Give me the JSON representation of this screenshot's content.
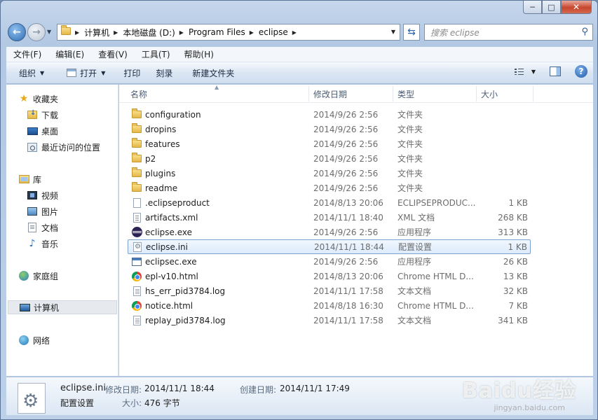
{
  "window": {
    "minimize_label": "─",
    "maximize_label": "□",
    "close_label": "✕"
  },
  "address": {
    "crumbs": [
      "计算机",
      "本地磁盘 (D:)",
      "Program Files",
      "eclipse"
    ]
  },
  "search": {
    "placeholder": "搜索 eclipse"
  },
  "menu": [
    "文件(F)",
    "编辑(E)",
    "查看(V)",
    "工具(T)",
    "帮助(H)"
  ],
  "toolbar": {
    "organize": "组织",
    "open": "打开",
    "print": "打印",
    "burn": "刻录",
    "new_folder": "新建文件夹"
  },
  "sidebar": {
    "favorites": "收藏夹",
    "downloads": "下载",
    "desktop": "桌面",
    "recent": "最近访问的位置",
    "libraries": "库",
    "videos": "视频",
    "pictures": "图片",
    "documents": "文档",
    "music": "音乐",
    "homegroup": "家庭组",
    "computer": "计算机",
    "network": "网络"
  },
  "columns": {
    "name": "名称",
    "date": "修改日期",
    "type": "类型",
    "size": "大小"
  },
  "files": [
    {
      "name": "configuration",
      "date": "2014/9/26 2:56",
      "type": "文件夹",
      "size": "",
      "icon": "folder-icon"
    },
    {
      "name": "dropins",
      "date": "2014/9/26 2:56",
      "type": "文件夹",
      "size": "",
      "icon": "folder-icon"
    },
    {
      "name": "features",
      "date": "2014/9/26 2:56",
      "type": "文件夹",
      "size": "",
      "icon": "folder-icon"
    },
    {
      "name": "p2",
      "date": "2014/9/26 2:56",
      "type": "文件夹",
      "size": "",
      "icon": "folder-icon"
    },
    {
      "name": "plugins",
      "date": "2014/9/26 2:56",
      "type": "文件夹",
      "size": "",
      "icon": "folder-icon"
    },
    {
      "name": "readme",
      "date": "2014/9/26 2:56",
      "type": "文件夹",
      "size": "",
      "icon": "folder-icon"
    },
    {
      "name": ".eclipseproduct",
      "date": "2014/8/13 20:06",
      "type": "ECLIPSEPRODUC...",
      "size": "1 KB",
      "icon": "file-icon"
    },
    {
      "name": "artifacts.xml",
      "date": "2014/11/1 18:40",
      "type": "XML 文档",
      "size": "268 KB",
      "icon": "xml-file-icon"
    },
    {
      "name": "eclipse.exe",
      "date": "2014/9/26 2:56",
      "type": "应用程序",
      "size": "313 KB",
      "icon": "eclipse-icon"
    },
    {
      "name": "eclipse.ini",
      "date": "2014/11/1 18:44",
      "type": "配置设置",
      "size": "1 KB",
      "icon": "ini-file-icon"
    },
    {
      "name": "eclipsec.exe",
      "date": "2014/9/26 2:56",
      "type": "应用程序",
      "size": "26 KB",
      "icon": "app-icon"
    },
    {
      "name": "epl-v10.html",
      "date": "2014/8/13 20:06",
      "type": "Chrome HTML D...",
      "size": "13 KB",
      "icon": "chrome-icon"
    },
    {
      "name": "hs_err_pid3784.log",
      "date": "2014/11/1 17:58",
      "type": "文本文档",
      "size": "32 KB",
      "icon": "text-file-icon"
    },
    {
      "name": "notice.html",
      "date": "2014/8/18 16:30",
      "type": "Chrome HTML D...",
      "size": "7 KB",
      "icon": "chrome-icon"
    },
    {
      "name": "replay_pid3784.log",
      "date": "2014/11/1 17:58",
      "type": "文本文档",
      "size": "341 KB",
      "icon": "text-file-icon"
    }
  ],
  "details": {
    "filename": "eclipse.ini",
    "filetype": "配置设置",
    "modified_label": "修改日期:",
    "modified_value": "2014/11/1 18:44",
    "created_label": "创建日期:",
    "created_value": "2014/11/1 17:49",
    "size_label": "大小:",
    "size_value": "476 字节"
  },
  "watermark": {
    "main": "Baidu经验",
    "sub": "jingyan.baidu.com"
  }
}
